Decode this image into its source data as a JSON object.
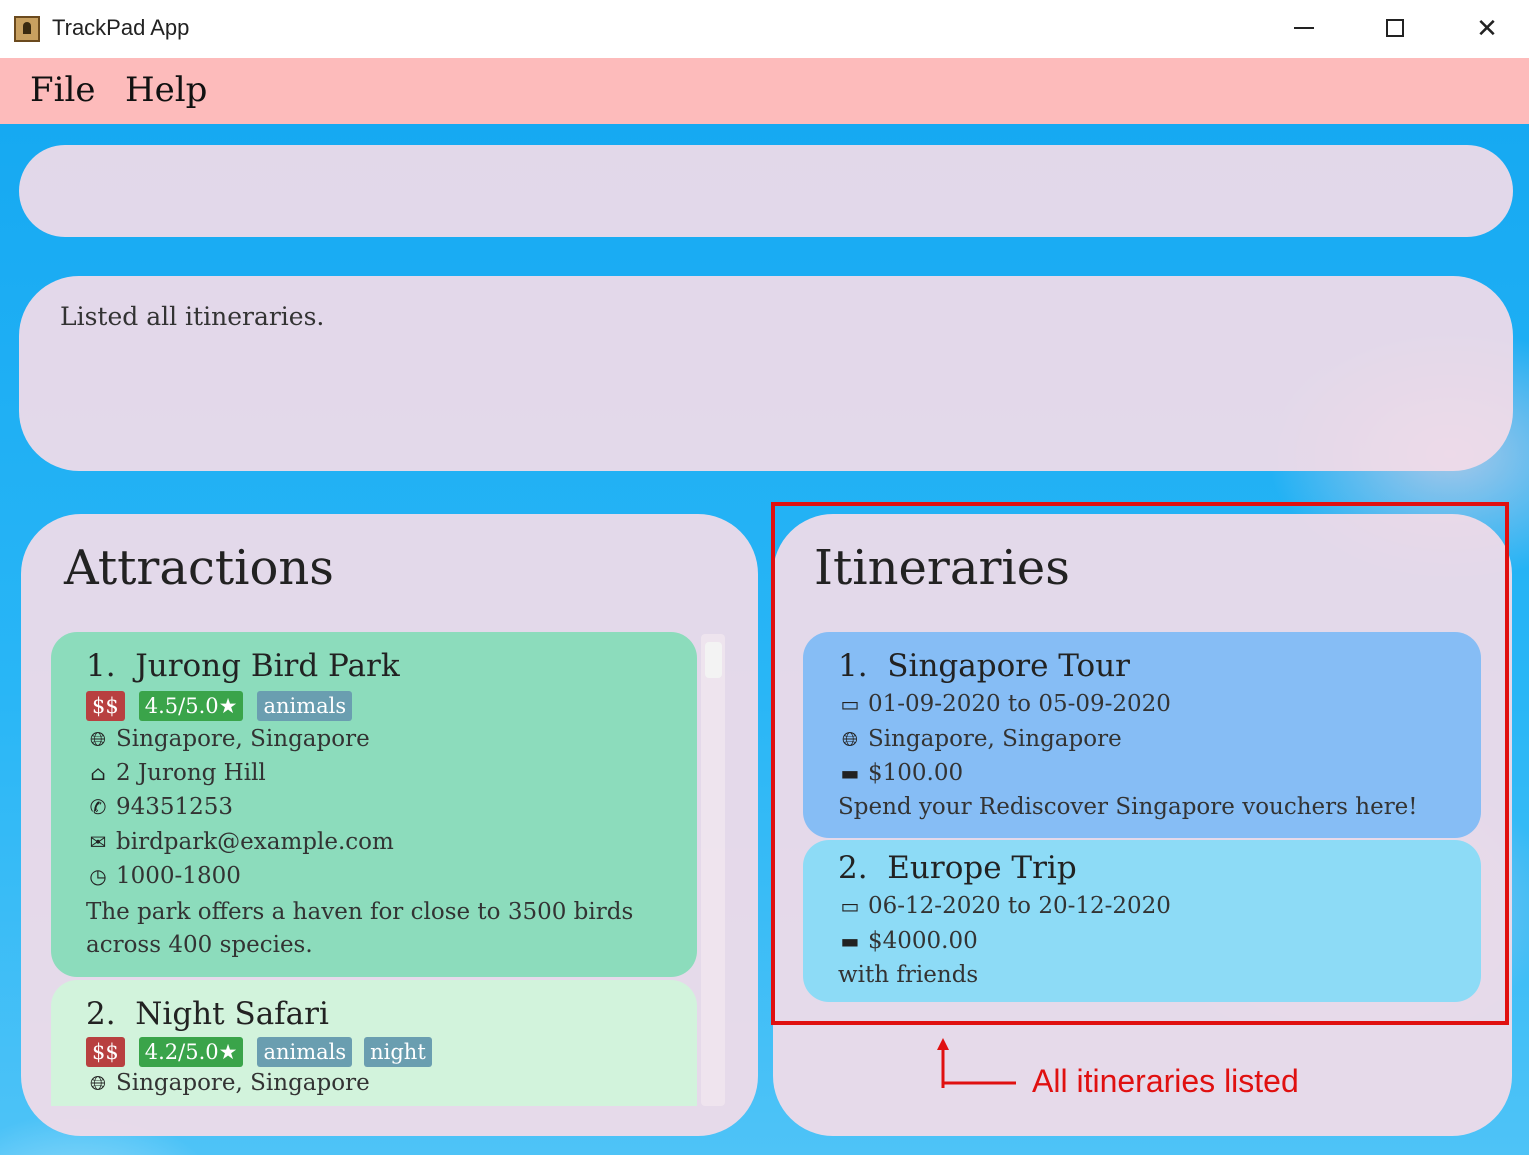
{
  "window": {
    "title": "TrackPad App"
  },
  "menu": {
    "file": "File",
    "help": "Help"
  },
  "command": {
    "value": ""
  },
  "result": {
    "message": "Listed all itineraries."
  },
  "attractions": {
    "title": "Attractions",
    "items": [
      {
        "index": "1.",
        "name": "Jurong Bird Park",
        "price": "$$",
        "rating": "4.5/5.0★",
        "tags": [
          "animals"
        ],
        "location": "Singapore, Singapore",
        "address": "2 Jurong Hill",
        "phone": "94351253",
        "email": "birdpark@example.com",
        "hours": "1000-1800",
        "description": "The park offers a haven for close to 3500 birds across 400 species."
      },
      {
        "index": "2.",
        "name": "Night Safari",
        "price": "$$",
        "rating": "4.2/5.0★",
        "tags": [
          "animals",
          "night"
        ],
        "location": "Singapore, Singapore"
      }
    ]
  },
  "itineraries": {
    "title": "Itineraries",
    "items": [
      {
        "index": "1.",
        "name": "Singapore Tour",
        "dates": "01-09-2020 to 05-09-2020",
        "location": "Singapore, Singapore",
        "budget": "$100.00",
        "description": "Spend your Rediscover Singapore vouchers here!"
      },
      {
        "index": "2.",
        "name": "Europe Trip",
        "dates": "06-12-2020 to 20-12-2020",
        "budget": "$4000.00",
        "description": "with friends"
      }
    ]
  },
  "annotation": {
    "text": "All itineraries listed",
    "color": "#e01010"
  },
  "colors": {
    "menu_bg": "#fdbbbb",
    "attraction_selected": "#8cdcbc",
    "attraction_card": "#d2f3dc",
    "itinerary_selected": "#86bdf5",
    "itinerary_card": "#8ddbf6"
  },
  "icons": [
    "globe-icon",
    "home-icon",
    "phone-icon",
    "email-icon",
    "clock-icon",
    "calendar-icon",
    "money-icon"
  ]
}
